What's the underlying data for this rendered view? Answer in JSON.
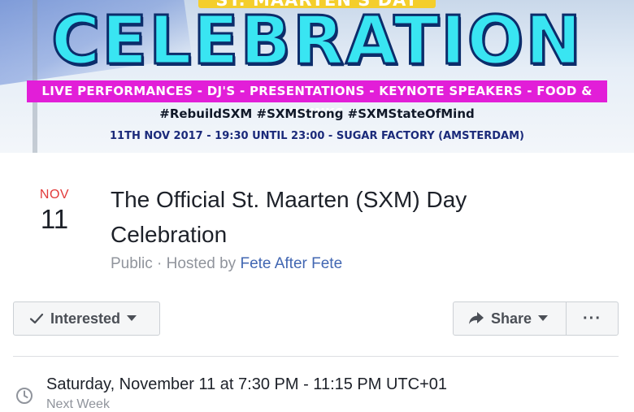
{
  "cover": {
    "top_text": "ST. MAARTEN'S DAY",
    "title": "CELEBRATION",
    "bar_text": "LIVE PERFORMANCES - DJ'S - PRESENTATIONS - KEYNOTE SPEAKERS - FOOD & DRINKS",
    "hashtags": "#RebuildSXM #SXMStrong #SXMStateOfMind",
    "date_line": "11TH NOV 2017 - 19:30 UNTIL 23:00 - SUGAR FACTORY (AMSTERDAM)",
    "colors": {
      "title": "#39e5f2",
      "bar": "#e21ed8",
      "pill": "#f4ce2c"
    }
  },
  "event": {
    "month": "NOV",
    "day": "11",
    "title": "The Official St. Maarten (SXM) Day Celebration",
    "privacy": "Public",
    "separator": " · ",
    "hosted_by_label": "Hosted by ",
    "host": "Fete After Fete"
  },
  "actions": {
    "interested_label": "Interested",
    "share_label": "Share",
    "more_label": "···",
    "icons": {
      "interested": "check-icon",
      "share": "share-arrow-icon",
      "caret": "caret-down-icon"
    }
  },
  "details": {
    "time": "Saturday, November 11 at 7:30 PM - 11:15 PM UTC+01",
    "time_sub": "Next Week",
    "icon": "clock-icon"
  },
  "colors": {
    "link": "#4267b2",
    "month": "#e23a3a",
    "muted": "#90949c"
  }
}
